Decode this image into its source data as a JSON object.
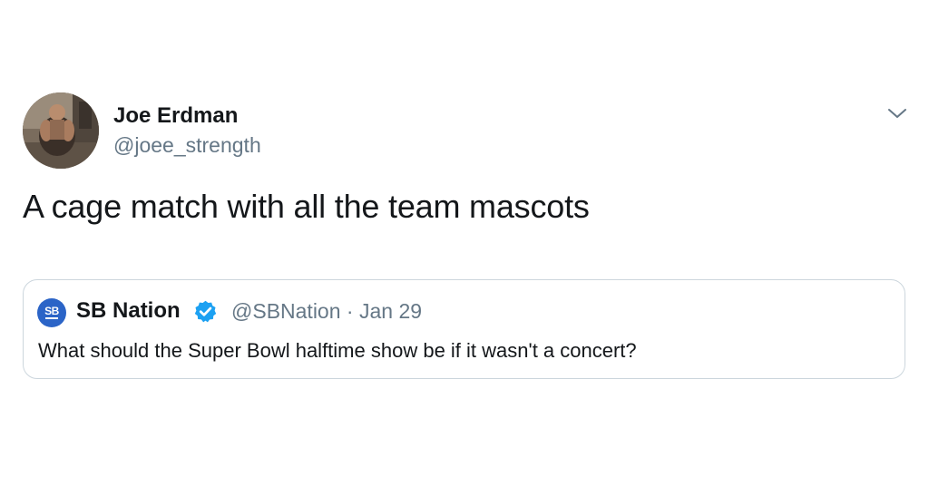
{
  "tweet": {
    "author": {
      "name": "Joe Erdman",
      "handle": "@joee_strength"
    },
    "text": "A cage match with all the team mascots",
    "menu_icon": "chevron-down-icon"
  },
  "quoted_tweet": {
    "logo_text": "SB",
    "name": "SB Nation",
    "verified_icon": "verified-badge-icon",
    "handle": "@SBNation",
    "separator": "·",
    "date": "Jan 29",
    "text": "What should the Super Bowl halftime show be if it wasn't a concert?"
  },
  "colors": {
    "text_primary": "#14171a",
    "text_secondary": "#657786",
    "border": "#ccd6dd",
    "verified_blue": "#1da1f2",
    "sbnation_blue": "#2b64c7"
  }
}
